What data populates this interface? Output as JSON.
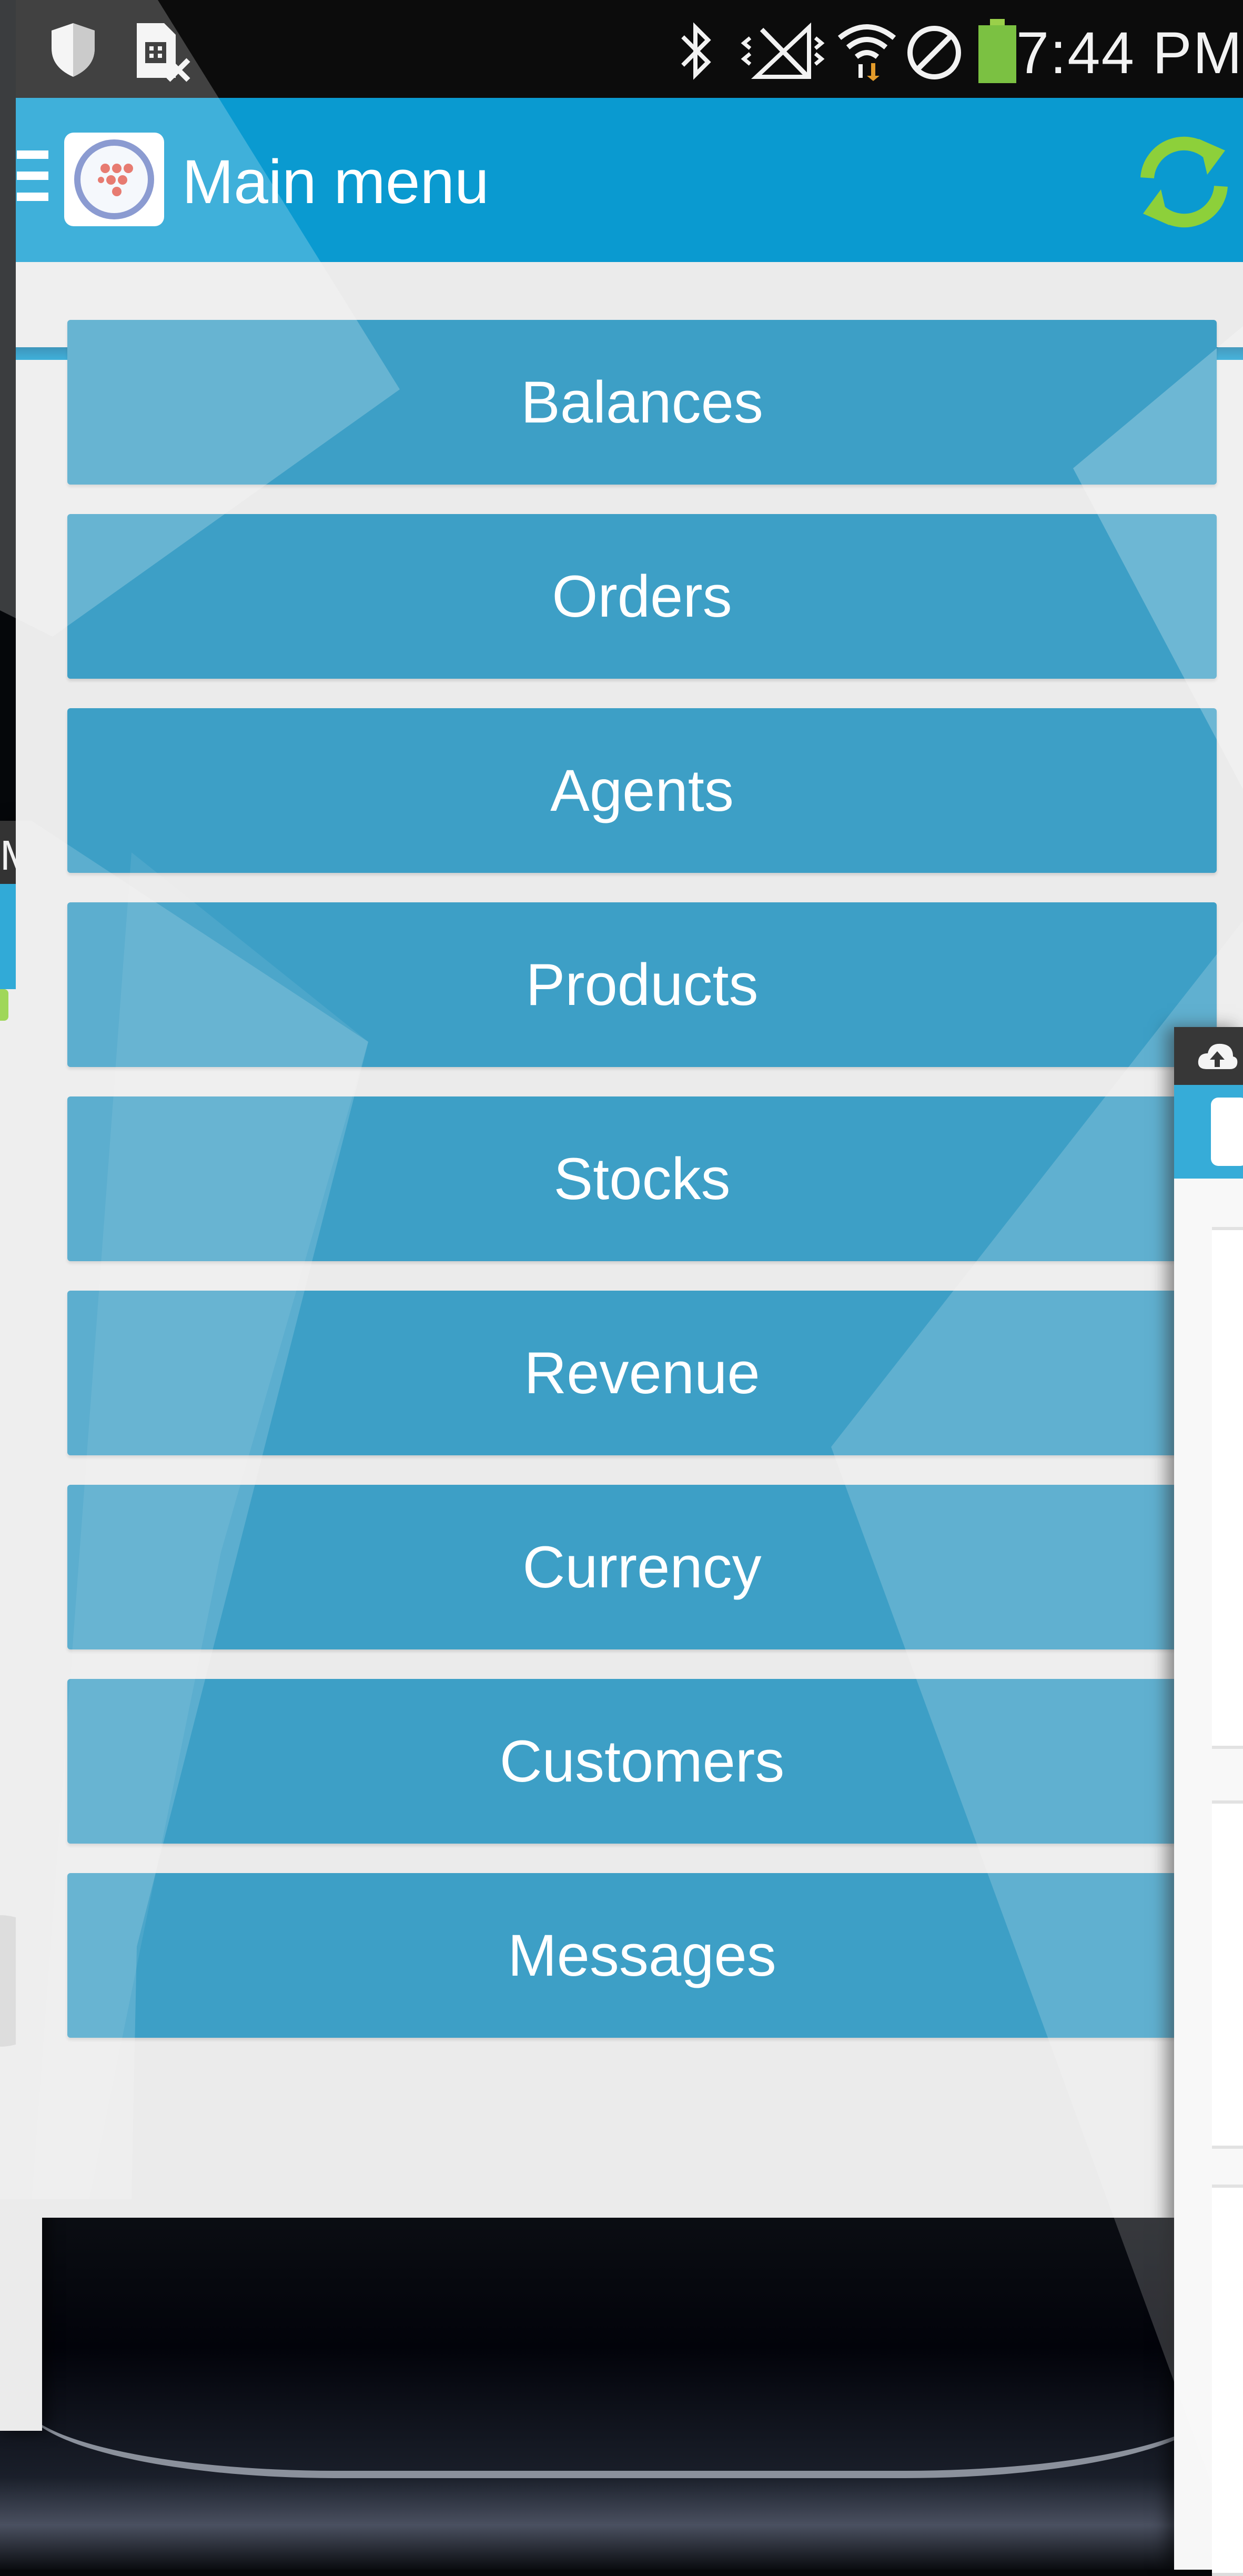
{
  "status_bar": {
    "time": "7:44 PM",
    "icons": [
      "shield-icon",
      "sim-error-icon",
      "bluetooth-icon",
      "no-signal-icon",
      "wifi-icon",
      "blocked-icon",
      "battery-icon"
    ]
  },
  "app_bar": {
    "title": "Main menu",
    "menu_icon": "hamburger-icon",
    "logo_icon": "app-logo-icon",
    "sync_icon": "sync-icon"
  },
  "menu": {
    "items": [
      {
        "label": "Balances"
      },
      {
        "label": "Orders"
      },
      {
        "label": "Agents"
      },
      {
        "label": "Products"
      },
      {
        "label": "Stocks"
      },
      {
        "label": "Revenue"
      },
      {
        "label": "Currency"
      },
      {
        "label": "Customers"
      },
      {
        "label": "Messages"
      }
    ]
  },
  "left_device": {
    "status_fragment": "M"
  },
  "colors": {
    "app_bar": "#0a9ad0",
    "menu_button": "#3d9fc6",
    "background": "#ebebeb",
    "sync_icon": "#8dd03a",
    "logo_dots": "#e0574a"
  }
}
